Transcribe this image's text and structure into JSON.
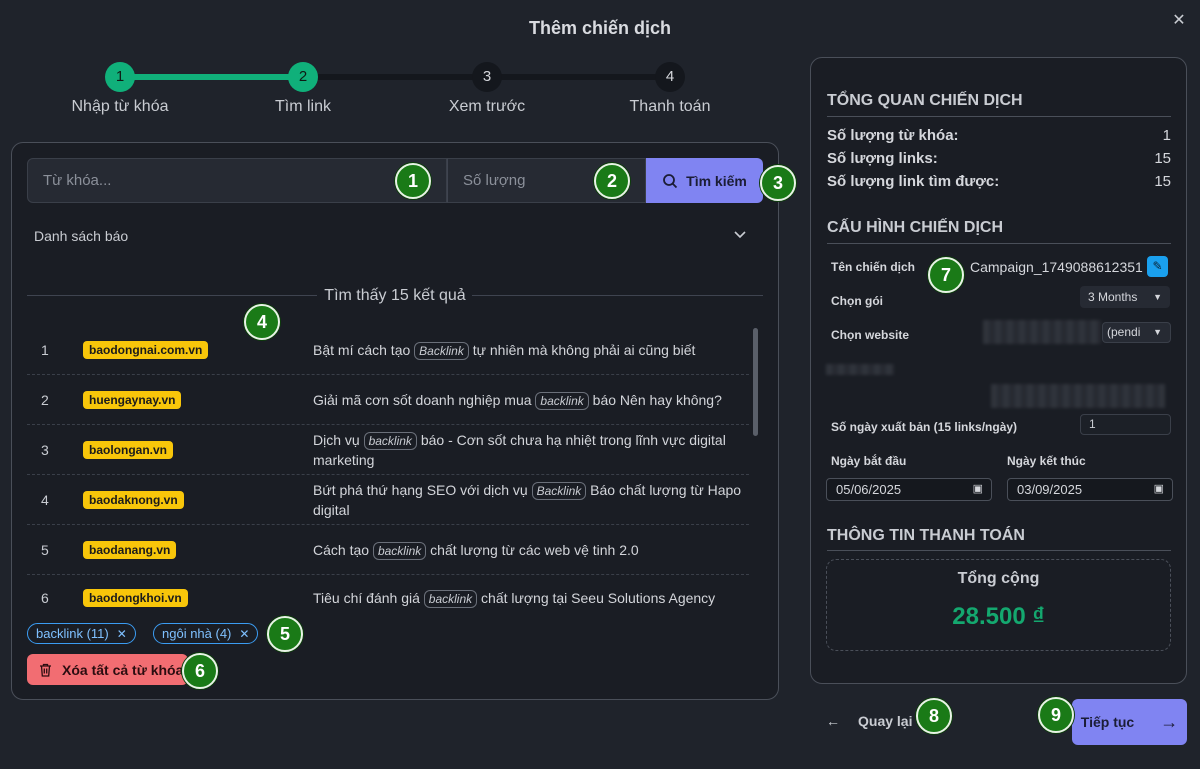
{
  "dialog": {
    "title": "Thêm chiến dịch",
    "close": "✕"
  },
  "steps": [
    {
      "num": "1",
      "label": "Nhập từ khóa"
    },
    {
      "num": "2",
      "label": "Tìm link"
    },
    {
      "num": "3",
      "label": "Xem trước"
    },
    {
      "num": "4",
      "label": "Thanh toán"
    }
  ],
  "search": {
    "keyword_placeholder": "Từ khóa...",
    "qty_placeholder": "Số lượng",
    "button_label": "Tìm kiếm"
  },
  "newspaper_list": {
    "label": "Danh sách báo",
    "chevron": "⌄"
  },
  "results": {
    "found_text": "Tìm thấy 15 kết quả",
    "rows": [
      {
        "num": "1",
        "domain": "baodongnai.com.vn",
        "pre": "Bật mí cách tạo ",
        "kw": "Backlink",
        "post": " tự nhiên mà không phải ai cũng biết"
      },
      {
        "num": "2",
        "domain": "huengaynay.vn",
        "pre": "Giải mã cơn sốt doanh nghiệp mua ",
        "kw": "backlink",
        "post": " báo Nên hay không?"
      },
      {
        "num": "3",
        "domain": "baolongan.vn",
        "pre": "Dịch vụ ",
        "kw": "backlink",
        "post": " báo - Cơn sốt chưa hạ nhiệt trong lĩnh vực digital marketing"
      },
      {
        "num": "4",
        "domain": "baodaknong.vn",
        "pre": "Bứt phá thứ hạng SEO với dịch vụ ",
        "kw": "Backlink",
        "post": " Báo chất lượng từ Hapo digital"
      },
      {
        "num": "5",
        "domain": "baodanang.vn",
        "pre": "Cách tạo ",
        "kw": "backlink",
        "post": " chất lượng từ các web vệ tinh 2.0"
      },
      {
        "num": "6",
        "domain": "baodongkhoi.vn",
        "pre": "Tiêu chí đánh giá ",
        "kw": "backlink",
        "post": " chất lượng tại Seeu Solutions Agency"
      }
    ]
  },
  "chips": [
    {
      "label": "backlink (11)"
    },
    {
      "label": "ngôi nhà (4)"
    }
  ],
  "delete_all": "Xóa tất cả từ khóa",
  "badges": [
    "1",
    "2",
    "3",
    "4",
    "5",
    "6",
    "7",
    "8",
    "9"
  ],
  "overview": {
    "title": "TỔNG QUAN CHIẾN DỊCH",
    "keyword_count_label": "Số lượng từ khóa:",
    "keyword_count": "1",
    "links_label": "Số lượng links:",
    "links": "15",
    "found_links_label": "Số lượng link tìm được:",
    "found_links": "15"
  },
  "config": {
    "title": "CẤU HÌNH CHIẾN DỊCH",
    "name_label": "Tên chiến dịch",
    "name_value": "Campaign_1749088612351",
    "package_label": "Chọn gói",
    "package_value": "3 Months",
    "website_label": "Chọn website",
    "website_value": "(pendi",
    "days_label": "Số ngày xuất bản (15 links/ngày)",
    "days_value": "1",
    "start_label": "Ngày bắt đầu",
    "start_value": "05/06/2025",
    "end_label": "Ngày kết thúc",
    "end_value": "03/09/2025"
  },
  "payment": {
    "title": "THÔNG TIN THANH TOÁN",
    "total_label": "Tổng cộng",
    "total_value": "28.500 ₫"
  },
  "footer": {
    "back": "Quay lại",
    "next": "Tiếp tục"
  },
  "colors": {
    "accent": "#8084f2",
    "success": "#10b07a",
    "danger": "#f26d72",
    "domain": "#f8c60a"
  }
}
